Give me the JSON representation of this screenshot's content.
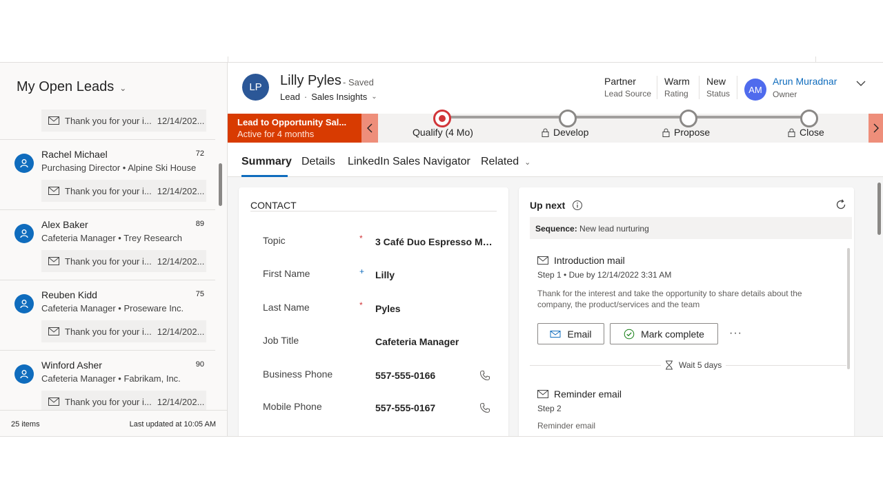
{
  "view": {
    "title": "My Open Leads"
  },
  "leads": [
    {
      "name": "",
      "score": "",
      "subtitle": "",
      "mail_text": "Thank you for your i...",
      "mail_date": "12/14/202..."
    },
    {
      "name": "Rachel Michael",
      "score": "72",
      "subtitle": "Purchasing Director • Alpine Ski House",
      "mail_text": "Thank you for your i...",
      "mail_date": "12/14/202..."
    },
    {
      "name": "Alex Baker",
      "score": "89",
      "subtitle": "Cafeteria Manager • Trey Research",
      "mail_text": "Thank you for your i...",
      "mail_date": "12/14/202..."
    },
    {
      "name": "Reuben Kidd",
      "score": "75",
      "subtitle": "Cafeteria Manager • Proseware Inc.",
      "mail_text": "Thank you for your i...",
      "mail_date": "12/14/202..."
    },
    {
      "name": "Winford Asher",
      "score": "90",
      "subtitle": "Cafeteria Manager • Fabrikam, Inc.",
      "mail_text": "Thank you for your i...",
      "mail_date": "12/14/202..."
    }
  ],
  "list_footer": {
    "count": "25 items",
    "updated": "Last updated at 10:05 AM"
  },
  "record": {
    "initials": "LP",
    "name": "Lilly Pyles",
    "saved": "- Saved",
    "type": "Lead",
    "form": "Sales Insights",
    "lead_source": {
      "value": "Partner",
      "label": "Lead Source"
    },
    "rating": {
      "value": "Warm",
      "label": "Rating"
    },
    "status": {
      "value": "New",
      "label": "Status"
    },
    "owner": {
      "initials": "AM",
      "name": "Arun Muradnar",
      "label": "Owner"
    }
  },
  "process": {
    "name": "Lead to Opportunity Sal...",
    "duration": "Active for 4 months",
    "stages": [
      {
        "label": "Qualify  (4 Mo)",
        "active": true
      },
      {
        "label": "Develop",
        "active": false
      },
      {
        "label": "Propose",
        "active": false
      },
      {
        "label": "Close",
        "active": false
      }
    ]
  },
  "tabs": [
    "Summary",
    "Details",
    "LinkedIn Sales Navigator",
    "Related"
  ],
  "contact": {
    "title": "CONTACT",
    "fields": [
      {
        "label": "Topic",
        "value": "3 Café Duo Espresso Mac...",
        "req": "*"
      },
      {
        "label": "First Name",
        "value": "Lilly",
        "req": "+"
      },
      {
        "label": "Last Name",
        "value": "Pyles",
        "req": "*"
      },
      {
        "label": "Job Title",
        "value": "Cafeteria Manager",
        "req": ""
      },
      {
        "label": "Business Phone",
        "value": "557-555-0166",
        "req": ""
      },
      {
        "label": "Mobile Phone",
        "value": "557-555-0167",
        "req": ""
      }
    ]
  },
  "upnext": {
    "title": "Up next",
    "sequence_label": "Sequence:",
    "sequence_name": "New lead nurturing",
    "step1": {
      "title": "Introduction mail",
      "sub": "Step 1 • Due by 12/14/2022 3:31 AM",
      "desc": "Thank for the interest and take the opportunity to share details about the company, the product/services and the team",
      "email_btn": "Email",
      "complete_btn": "Mark complete",
      "more": "···"
    },
    "wait": "Wait 5 days",
    "step2": {
      "title": "Reminder email",
      "sub": "Step 2",
      "desc": "Reminder email"
    }
  },
  "colors": {
    "brand": "#0f6cbd",
    "process_active": "#d83b01",
    "stage_active": "#d13438"
  }
}
